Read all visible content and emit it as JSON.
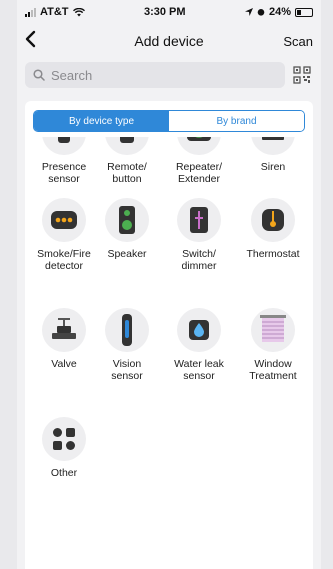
{
  "statusbar": {
    "carrier": "AT&T",
    "time": "3:30 PM",
    "battery": "24%"
  },
  "navbar": {
    "back_icon": "chevron-left-icon",
    "title": "Add device",
    "scan_label": "Scan"
  },
  "search": {
    "placeholder": "Search"
  },
  "segment": {
    "active": "By device type",
    "inactive": "By brand"
  },
  "colors": {
    "accent": "#2f88d8",
    "orange": "#f3a51b",
    "green": "#4caf50"
  },
  "devices": [
    {
      "label": "Presence\nsensor",
      "icon": "presence-sensor-icon"
    },
    {
      "label": "Remote/\nbutton",
      "icon": "remote-icon"
    },
    {
      "label": "Repeater/\nExtender",
      "icon": "repeater-icon"
    },
    {
      "label": "Siren",
      "icon": "siren-icon"
    },
    {
      "label": "Smoke/Fire\ndetector",
      "icon": "smoke-detector-icon"
    },
    {
      "label": "Speaker",
      "icon": "speaker-icon"
    },
    {
      "label": "Switch/\ndimmer",
      "icon": "switch-icon"
    },
    {
      "label": "Thermostat",
      "icon": "thermostat-icon"
    },
    {
      "label": "Valve",
      "icon": "valve-icon"
    },
    {
      "label": "Vision\nsensor",
      "icon": "vision-sensor-icon"
    },
    {
      "label": "Water leak\nsensor",
      "icon": "water-leak-icon"
    },
    {
      "label": "Window\nTreatment",
      "icon": "window-treatment-icon"
    },
    {
      "label": "Other",
      "icon": "other-icon"
    }
  ]
}
